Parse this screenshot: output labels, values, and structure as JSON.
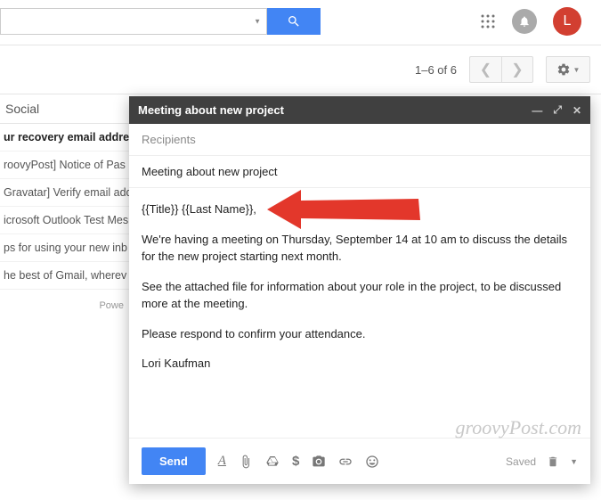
{
  "header": {
    "avatar_letter": "L"
  },
  "toolbar": {
    "page_count": "1–6 of 6"
  },
  "tab": {
    "label": "Social"
  },
  "inbox": {
    "items": [
      {
        "text": "ur recovery email addre",
        "bold": true
      },
      {
        "text": "roovyPost] Notice of Pas",
        "bold": false
      },
      {
        "text": "Gravatar] Verify email add",
        "bold": false
      },
      {
        "text": "icrosoft Outlook Test Mes",
        "bold": false
      },
      {
        "text": "ps for using your new inb",
        "bold": false
      },
      {
        "text": "he best of Gmail, wherev",
        "bold": false
      }
    ],
    "powered": "Powe"
  },
  "compose": {
    "title": "Meeting about new project",
    "recipients_label": "Recipients",
    "subject": "Meeting about new project",
    "body": {
      "greeting": "{{Title}} {{Last Name}},",
      "p1": "We're having a meeting on Thursday, September 14 at 10 am to discuss the details for the new project starting next month.",
      "p2": "See the attached file for information about your role in the project, to be discussed more at the meeting.",
      "p3": "Please respond to confirm your attendance.",
      "signature": "Lori Kaufman"
    },
    "send_label": "Send",
    "saved_label": "Saved"
  },
  "watermark": "groovyPost.com"
}
